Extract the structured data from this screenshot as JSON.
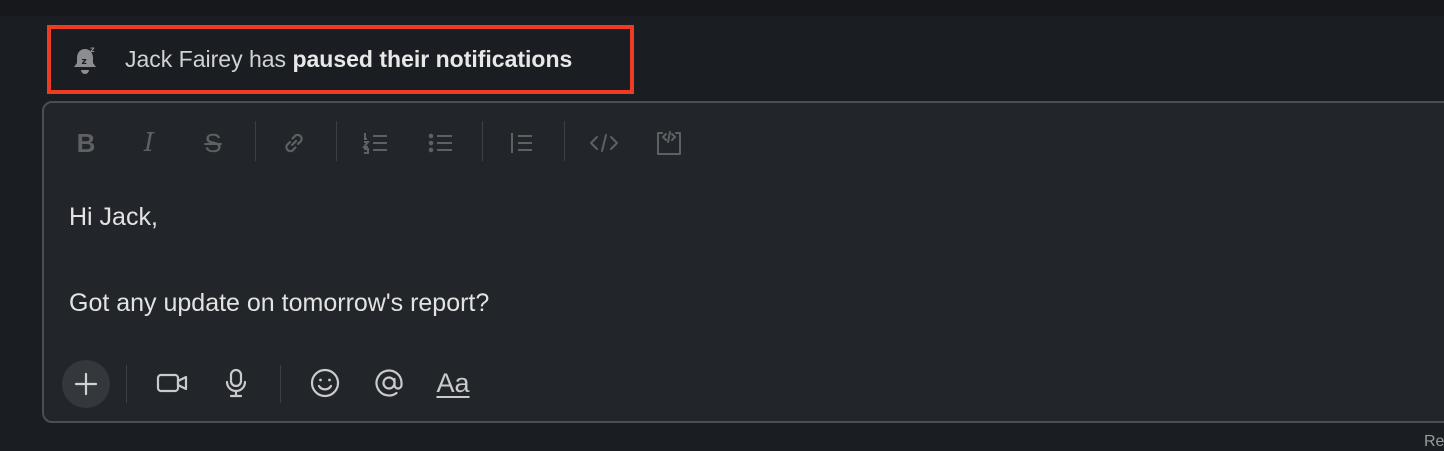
{
  "notice": {
    "icon": "bell-snooze-icon",
    "plain_text": "Jack Fairey has ",
    "bold_text": "paused their notifications",
    "highlight_color": "#ef3b24"
  },
  "formatting_toolbar": {
    "bold_glyph": "B",
    "italic_glyph": "I",
    "strike_glyph": "S",
    "icons": [
      "bold-icon",
      "italic-icon",
      "strikethrough-icon",
      "link-icon",
      "ordered-list-icon",
      "bulleted-list-icon",
      "blockquote-icon",
      "code-icon",
      "code-block-icon"
    ]
  },
  "message": {
    "line1": "Hi Jack,",
    "line2": "Got any update on tomorrow's report?"
  },
  "actions_toolbar": {
    "icons": [
      "plus-icon",
      "video-icon",
      "microphone-icon",
      "emoji-icon",
      "mention-icon",
      "text-format-icon"
    ],
    "mention_glyph": "@",
    "format_label": "Aa"
  },
  "corner_text": "Re"
}
